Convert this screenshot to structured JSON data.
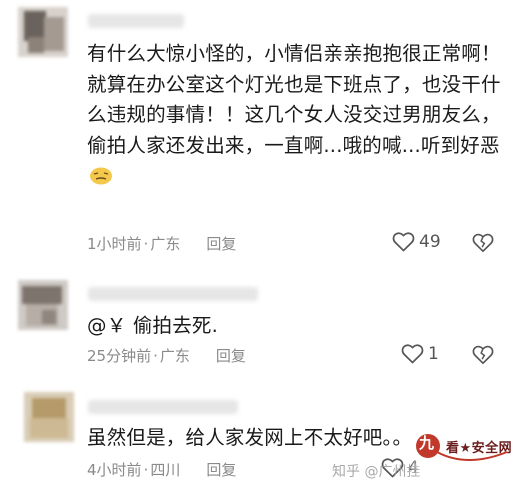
{
  "comments": [
    {
      "body": "有什么大惊小怪的，小情侣亲亲抱抱很正常啊！就算在办公室这个灯光也是下班点了，也没干什么违规的事情！！这几个女人没交过男朋友么，偷拍人家还发出来，一直啊...哦的喊...听到好恶",
      "time": "1小时前",
      "location": "广东",
      "reply_label": "回复",
      "likes": "49",
      "emoji_icon": "disgust-face-emoji"
    },
    {
      "mention": "@￥",
      "body": "偷拍去死.",
      "time": "25分钟前",
      "location": "广东",
      "reply_label": "回复",
      "likes": "1"
    },
    {
      "body": "虽然但是，给人家发网上不太好吧。。",
      "time": "4小时前",
      "location": "四川",
      "reply_label": "回复",
      "likes": "4"
    }
  ],
  "separator": "·",
  "watermark": {
    "text": "知乎 @广州挂"
  },
  "colors": {
    "text": "#1a1a1a",
    "meta": "#8a8a8a",
    "icon": "#555555",
    "logo_red": "#c0392b"
  }
}
